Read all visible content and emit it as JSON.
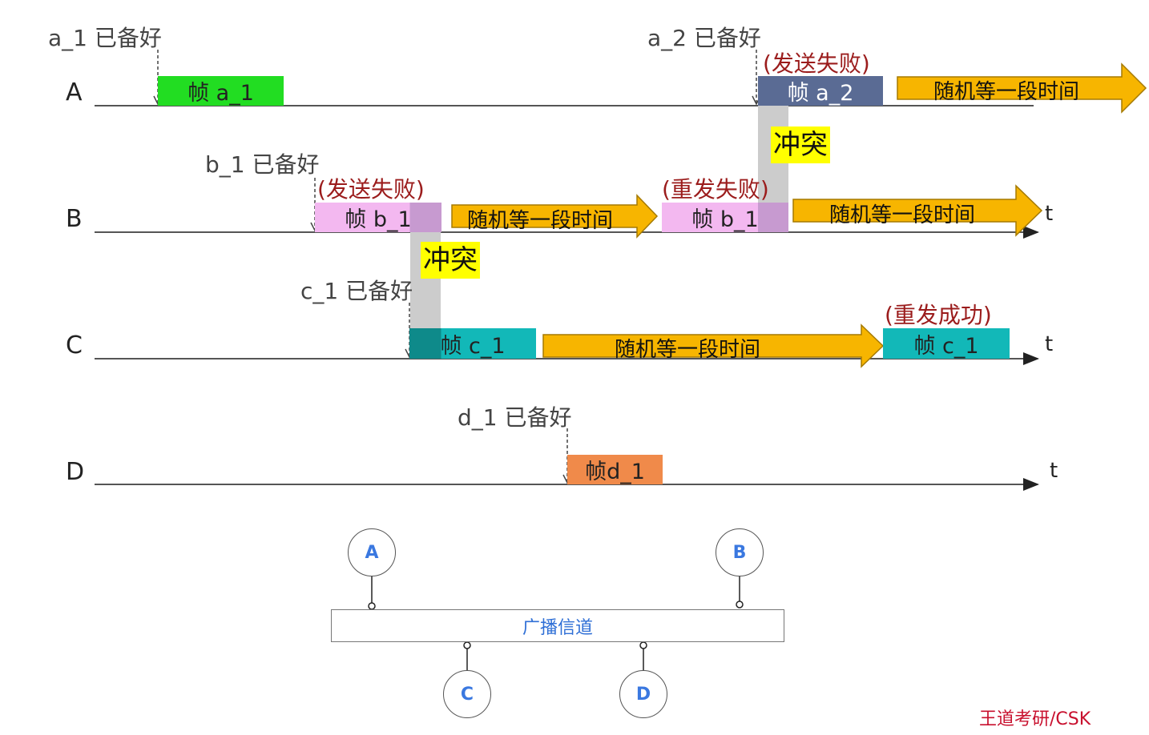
{
  "nodes": [
    "A",
    "B",
    "C",
    "D"
  ],
  "ready_labels": {
    "a1": "a_1 已备好",
    "a2": "a_2 已备好",
    "b1": "b_1 已备好",
    "c1": "c_1 已备好",
    "d1": "d_1 已备好"
  },
  "status_labels": {
    "a2_fail": "(发送失败)",
    "b1_fail": "(发送失败)",
    "b1_retry_fail": "(重发失败)",
    "c1_retry_ok": "(重发成功)"
  },
  "frames": {
    "a1": "帧 a_1",
    "a2": "帧 a_2",
    "b1": "帧 b_1",
    "b1_retry": "帧 b_1",
    "c1": "帧 c_1",
    "c1_retry": "帧 c_1",
    "d1": "帧d_1"
  },
  "collision_label": "冲突",
  "wait_label": "随机等一段时间",
  "time_label": "t",
  "channel_label": "广播信道",
  "stations": [
    "A",
    "B",
    "C",
    "D"
  ],
  "watermark": "王道考研/CSK",
  "colors": {
    "frame_a1": "#22dd22",
    "frame_a2": "#5a6b94",
    "frame_b1": "#f3b8f0",
    "frame_b1_overlap": "#c79ad0",
    "frame_c1": "#12b8b8",
    "frame_c1_dark": "#0e8a8a",
    "frame_d1": "#f08a4a",
    "wait_arrow": "#f7b500",
    "collision_bar": "#cccccc",
    "status_text": "#9b1c1c",
    "channel_text": "#2f6fd6"
  }
}
